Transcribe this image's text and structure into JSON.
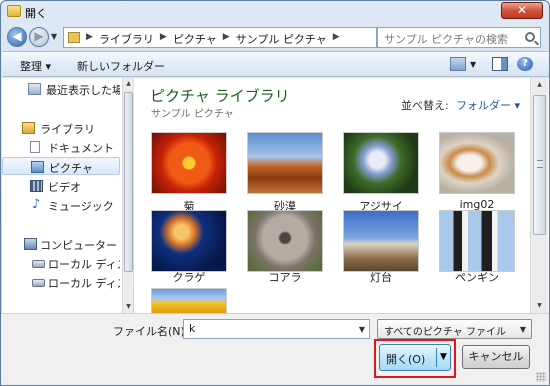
{
  "window": {
    "title": "開く",
    "close_glyph": "✕"
  },
  "nav": {
    "back_glyph": "◀",
    "forward_glyph": "▶",
    "breadcrumbs": [
      "ライブラリ",
      "ピクチャ",
      "サンプル ピクチャ"
    ],
    "refresh_glyph": "↻",
    "search_placeholder": "サンプル ピクチャの検索"
  },
  "toolbar": {
    "organize": "整理 ▾",
    "new_folder": "新しいフォルダー",
    "help": "?"
  },
  "sidebar": {
    "items": [
      {
        "label": "最近表示した場所",
        "icon": "recent-places-icon"
      },
      {
        "label": "ライブラリ",
        "icon": "library-icon"
      },
      {
        "label": "ドキュメント",
        "icon": "documents-icon"
      },
      {
        "label": "ピクチャ",
        "icon": "pictures-icon",
        "selected": true
      },
      {
        "label": "ビデオ",
        "icon": "videos-icon"
      },
      {
        "label": "ミュージック",
        "icon": "music-icon"
      },
      {
        "label": "コンピューター",
        "icon": "computer-icon"
      },
      {
        "label": "ローカル ディスク",
        "icon": "local-disk-icon"
      },
      {
        "label": "ローカル ディスク",
        "icon": "local-disk-icon"
      }
    ]
  },
  "content": {
    "library_title": "ピクチャ ライブラリ",
    "library_subtitle": "サンプル ピクチャ",
    "arrange_label": "並べ替え:",
    "arrange_value": "フォルダー ▾",
    "files": [
      {
        "name": "菊"
      },
      {
        "name": "砂漠"
      },
      {
        "name": "アジサイ"
      },
      {
        "name": "img02"
      },
      {
        "name": "クラゲ"
      },
      {
        "name": "コアラ"
      },
      {
        "name": "灯台"
      },
      {
        "name": "ペンギン"
      },
      {
        "name": ""
      }
    ]
  },
  "bottom": {
    "filename_label": "ファイル名(N):",
    "filename_value": "k",
    "filetype_value": "すべてのピクチャ ファイル",
    "open_label": "開く(O)",
    "cancel_label": "キャンセル"
  },
  "colors": {
    "highlight": "#e5141b",
    "library_title": "#1e5f1e",
    "link": "#1e5aa8"
  }
}
